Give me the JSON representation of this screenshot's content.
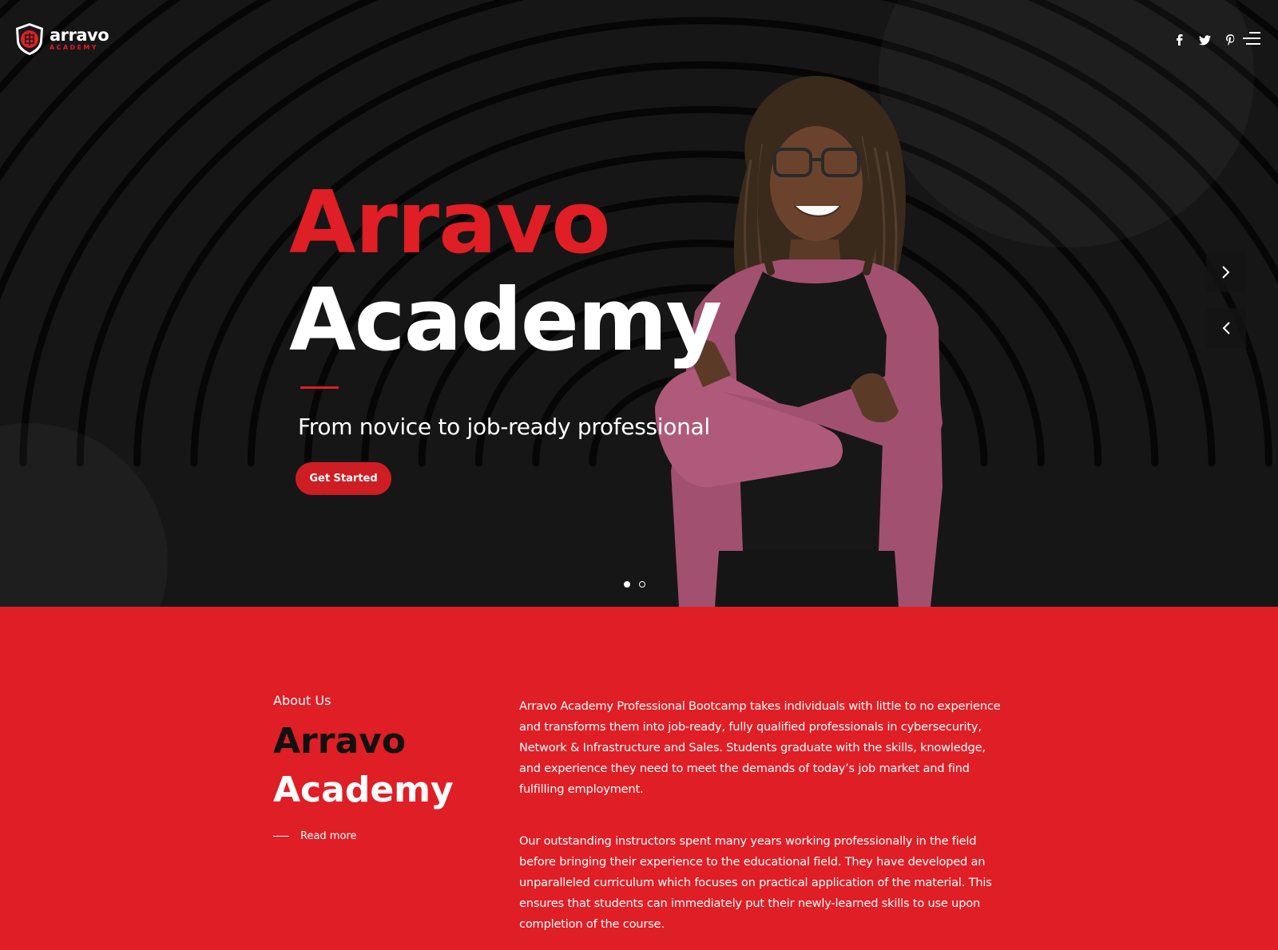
{
  "brand": {
    "name": "arravo",
    "sub": "ACADEMY"
  },
  "header": {
    "social": [
      {
        "icon": "facebook-icon",
        "glyph": "f"
      },
      {
        "icon": "twitter-icon",
        "glyph": "t"
      },
      {
        "icon": "pinterest-icon",
        "glyph": "p"
      }
    ]
  },
  "hero": {
    "title_line_1": "Arravo",
    "title_line_2": "Academy",
    "subtitle": "From novice to job-ready professional",
    "cta_label": "Get Started",
    "slide_count": 2,
    "active_slide": 1
  },
  "about": {
    "label": "About Us",
    "title_line_1": "Arravo",
    "title_line_2": "Academy",
    "read_more": "Read more",
    "paragraph_1": "Arravo Academy Professional Bootcamp takes individuals with little to no experience and transforms them into job-ready, fully qualified professionals in cybersecurity, Network & Infrastructure and Sales. Students graduate with the skills, knowledge, and experience they need to meet the demands of today’s job market and find fulfilling employment.",
    "paragraph_2": "Our outstanding instructors spent many years working professionally in the field before bringing their experience to the educational field. They have developed an unparalleled curriculum which focuses on practical application of the material. This ensures that students can immediately put their newly-learned skills to use upon completion of the course."
  },
  "colors": {
    "brand_red": "#e01e25",
    "hero_bg": "#161616",
    "button_red": "#cf1d24"
  }
}
